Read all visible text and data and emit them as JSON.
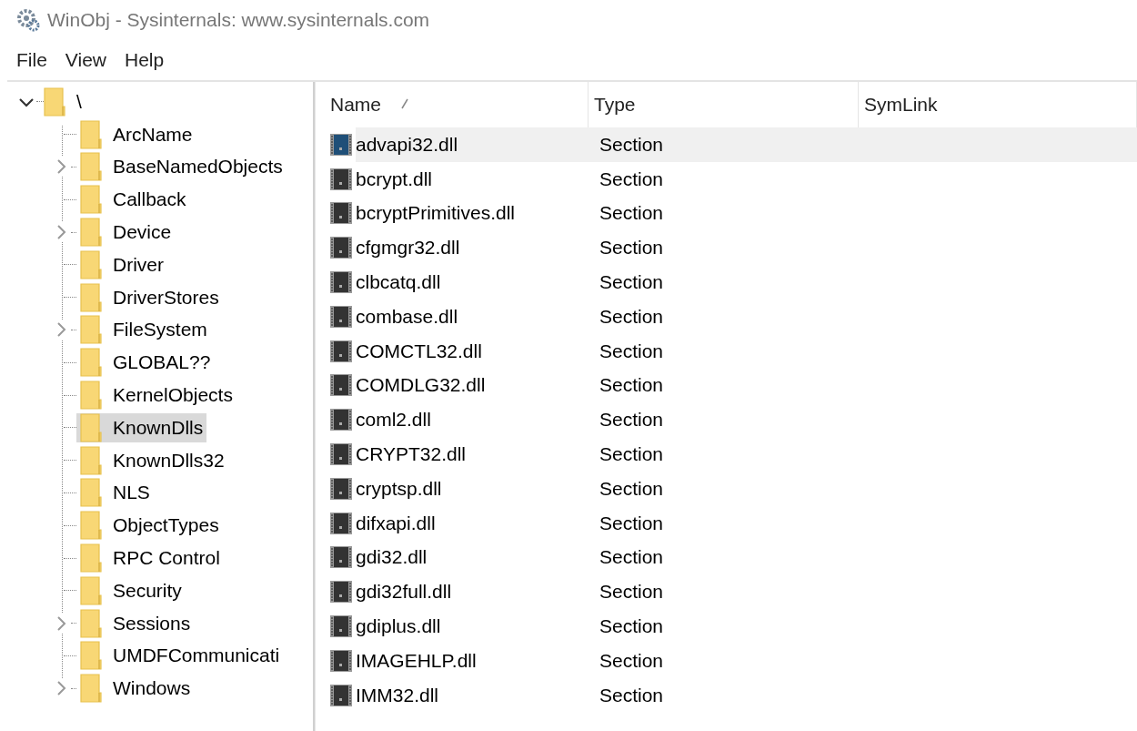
{
  "window": {
    "title": "WinObj - Sysinternals: www.sysinternals.com"
  },
  "menu": [
    "File",
    "View",
    "Help"
  ],
  "tree": {
    "label": "\\",
    "expanded": true,
    "selected": false,
    "children": [
      {
        "label": "ArcName",
        "expandable": false,
        "selected": false
      },
      {
        "label": "BaseNamedObjects",
        "expandable": true,
        "selected": false
      },
      {
        "label": "Callback",
        "expandable": false,
        "selected": false
      },
      {
        "label": "Device",
        "expandable": true,
        "selected": false
      },
      {
        "label": "Driver",
        "expandable": false,
        "selected": false
      },
      {
        "label": "DriverStores",
        "expandable": false,
        "selected": false
      },
      {
        "label": "FileSystem",
        "expandable": true,
        "selected": false
      },
      {
        "label": "GLOBAL??",
        "expandable": false,
        "selected": false
      },
      {
        "label": "KernelObjects",
        "expandable": false,
        "selected": false
      },
      {
        "label": "KnownDlls",
        "expandable": false,
        "selected": true
      },
      {
        "label": "KnownDlls32",
        "expandable": false,
        "selected": false
      },
      {
        "label": "NLS",
        "expandable": false,
        "selected": false
      },
      {
        "label": "ObjectTypes",
        "expandable": false,
        "selected": false
      },
      {
        "label": "RPC Control",
        "expandable": false,
        "selected": false
      },
      {
        "label": "Security",
        "expandable": false,
        "selected": false
      },
      {
        "label": "Sessions",
        "expandable": true,
        "selected": false
      },
      {
        "label": "UMDFCommunicati",
        "expandable": false,
        "selected": false
      },
      {
        "label": "Windows",
        "expandable": true,
        "selected": false
      }
    ]
  },
  "table": {
    "columns": [
      {
        "label": "Name"
      },
      {
        "label": "Type"
      },
      {
        "label": "SymLink"
      }
    ],
    "rows": [
      {
        "name": "advapi32.dll",
        "type": "Section",
        "selected": true
      },
      {
        "name": "bcrypt.dll",
        "type": "Section",
        "selected": false
      },
      {
        "name": "bcryptPrimitives.dll",
        "type": "Section",
        "selected": false
      },
      {
        "name": "cfgmgr32.dll",
        "type": "Section",
        "selected": false
      },
      {
        "name": "clbcatq.dll",
        "type": "Section",
        "selected": false
      },
      {
        "name": "combase.dll",
        "type": "Section",
        "selected": false
      },
      {
        "name": "COMCTL32.dll",
        "type": "Section",
        "selected": false
      },
      {
        "name": "COMDLG32.dll",
        "type": "Section",
        "selected": false
      },
      {
        "name": "coml2.dll",
        "type": "Section",
        "selected": false
      },
      {
        "name": "CRYPT32.dll",
        "type": "Section",
        "selected": false
      },
      {
        "name": "cryptsp.dll",
        "type": "Section",
        "selected": false
      },
      {
        "name": "difxapi.dll",
        "type": "Section",
        "selected": false
      },
      {
        "name": "gdi32.dll",
        "type": "Section",
        "selected": false
      },
      {
        "name": "gdi32full.dll",
        "type": "Section",
        "selected": false
      },
      {
        "name": "gdiplus.dll",
        "type": "Section",
        "selected": false
      },
      {
        "name": "IMAGEHLP.dll",
        "type": "Section",
        "selected": false
      },
      {
        "name": "IMM32.dll",
        "type": "Section",
        "selected": false
      }
    ]
  }
}
